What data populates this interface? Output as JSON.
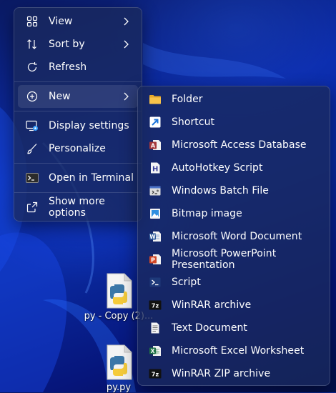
{
  "main_menu": {
    "items": [
      {
        "label": "View",
        "icon": "grid-icon",
        "has_submenu": true
      },
      {
        "label": "Sort by",
        "icon": "sort-icon",
        "has_submenu": true
      },
      {
        "label": "Refresh",
        "icon": "refresh-icon",
        "has_submenu": false
      },
      {
        "label": "New",
        "icon": "plus-circle-icon",
        "has_submenu": true,
        "active": true
      },
      {
        "label": "Display settings",
        "icon": "display-icon",
        "has_submenu": false
      },
      {
        "label": "Personalize",
        "icon": "brush-icon",
        "has_submenu": false
      },
      {
        "label": "Open in Terminal",
        "icon": "terminal-icon",
        "has_submenu": false
      },
      {
        "label": "Show more options",
        "icon": "share-icon",
        "has_submenu": false
      }
    ]
  },
  "new_submenu": {
    "items": [
      {
        "label": "Folder",
        "icon": "folder-icon"
      },
      {
        "label": "Shortcut",
        "icon": "shortcut-icon"
      },
      {
        "label": "Microsoft Access Database",
        "icon": "access-icon"
      },
      {
        "label": "AutoHotkey Script",
        "icon": "autohotkey-icon"
      },
      {
        "label": "Windows Batch File",
        "icon": "batch-file-icon"
      },
      {
        "label": "Bitmap image",
        "icon": "bitmap-icon"
      },
      {
        "label": "Microsoft Word Document",
        "icon": "word-icon"
      },
      {
        "label": "Microsoft PowerPoint Presentation",
        "icon": "powerpoint-icon"
      },
      {
        "label": "Script",
        "icon": "script-icon"
      },
      {
        "label": "WinRAR archive",
        "icon": "winrar-icon"
      },
      {
        "label": "Text Document",
        "icon": "text-document-icon"
      },
      {
        "label": "Microsoft Excel Worksheet",
        "icon": "excel-icon"
      },
      {
        "label": "WinRAR ZIP archive",
        "icon": "winrar-zip-icon"
      }
    ]
  },
  "desktop": {
    "icons": [
      {
        "label": "py - Copy (2)...",
        "icon": "python-file-icon"
      },
      {
        "label": "py.py",
        "icon": "python-file-icon"
      }
    ]
  },
  "colors": {
    "menu_bg": "#19295c",
    "accent": "#0b2cae",
    "word": "#2b5797",
    "excel": "#1e7145",
    "powerpoint": "#d24726",
    "access": "#a4373a",
    "folder": "#f8c34a"
  }
}
